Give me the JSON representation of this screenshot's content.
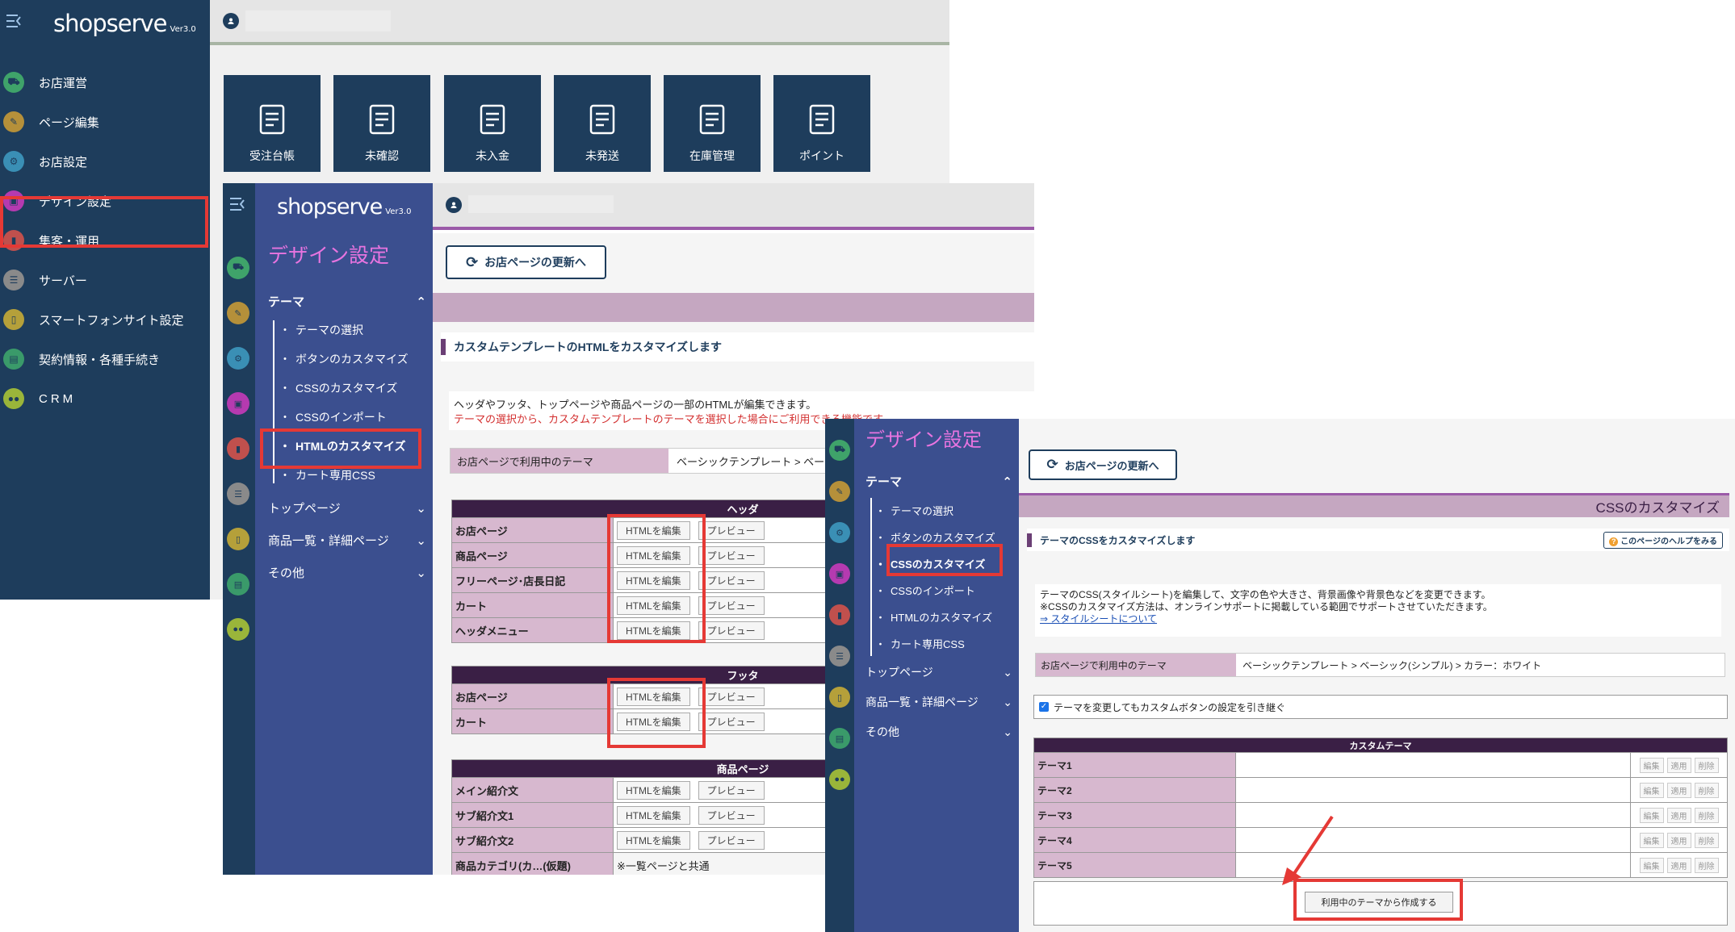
{
  "brand": {
    "name": "shopserve",
    "version": "Ver3.0"
  },
  "panel1": {
    "nav": [
      {
        "label": "お店運営",
        "icon": "cart-icon",
        "color": "#3fa36a"
      },
      {
        "label": "ページ編集",
        "icon": "edit-icon",
        "color": "#b5903a"
      },
      {
        "label": "お店設定",
        "icon": "gear-icon",
        "color": "#3a8fb5"
      },
      {
        "label": "デザイン設定",
        "icon": "layout-icon",
        "color": "#b53ab0"
      },
      {
        "label": "集客・運用",
        "icon": "chart-icon",
        "color": "#c0504d"
      },
      {
        "label": "サーバー",
        "icon": "server-icon",
        "color": "#8a8a8a"
      },
      {
        "label": "スマートフォンサイト設定",
        "icon": "smartphone-icon",
        "color": "#b5a03a"
      },
      {
        "label": "契約情報・各種手続き",
        "icon": "document-icon",
        "color": "#3a9a6a"
      },
      {
        "label": "CRM",
        "icon": "users-icon",
        "color": "#9ab53a"
      }
    ],
    "tiles": [
      {
        "label": "受注台帳",
        "icon": "clipboard-icon"
      },
      {
        "label": "未確認",
        "icon": "search-document-icon"
      },
      {
        "label": "未入金",
        "icon": "card-icon"
      },
      {
        "label": "未発送",
        "icon": "truck-icon"
      },
      {
        "label": "在庫管理",
        "icon": "box-icon"
      },
      {
        "label": "ポイント",
        "icon": "coins-icon"
      }
    ]
  },
  "panel2": {
    "title": "デザイン設定",
    "refresh_button": "お店ページの更新へ",
    "sections": {
      "theme": "テーマ",
      "top": "トップページ",
      "goods": "商品一覧・詳細ページ",
      "other": "その他"
    },
    "theme_items": [
      "テーマの選択",
      "ボタンのカスタマイズ",
      "CSSのカスタマイズ",
      "CSSのインポート",
      "HTMLのカスタマイズ",
      "カート専用CSS"
    ],
    "heading": "カスタムテンプレートのHTMLをカスタマイズします",
    "desc1": "ヘッダやフッタ、トップページや商品ページの一部のHTMLが編集できます。",
    "desc2": "テーマの選択から、カスタムテンプレートのテーマを選択した場合にご利用できる機能です。",
    "current_theme_label": "お店ページで利用中のテーマ",
    "current_theme_value": "ベーシックテンプレート > ベーシッ",
    "edit_label": "HTMLを編集",
    "preview_label": "プレビュー",
    "header_table": {
      "title": "ヘッダ",
      "rows": [
        "お店ページ",
        "商品ページ",
        "フリーページ･店長日記",
        "カート",
        "ヘッダメニュー"
      ]
    },
    "footer_table": {
      "title": "フッタ",
      "rows": [
        "お店ページ",
        "カート"
      ]
    },
    "goods_table": {
      "title": "商品ページ",
      "rows": [
        "メイン紹介文",
        "サブ紹介文1",
        "サブ紹介文2"
      ],
      "cut_label": "商品カテゴリ(カ…(仮題)",
      "cut_note": "※一覧ページと共通"
    }
  },
  "panel3": {
    "title": "デザイン設定",
    "refresh_button": "お店ページの更新へ",
    "band_title": "CSSのカスタマイズ",
    "heading": "テーマのCSSをカスタマイズします",
    "help_button": "このページのヘルプをみる",
    "desc1": "テーマのCSS(スタイルシート)を編集して、文字の色や大きさ、背景画像や背景色などを変更できます。",
    "desc2": "※CSSのカスタマイズ方法は、オンラインサポートに掲載している範囲でサポートさせていただきます。",
    "desc_link": "⇒ スタイルシートについて",
    "current_theme_label": "お店ページで利用中のテーマ",
    "current_theme_value": "ベーシックテンプレート > ベーシック(シンプル) > カラー：ホワイト",
    "checkbox_label": "テーマを変更してもカスタムボタンの設定を引き継ぐ",
    "custom_theme_title": "カスタムテーマ",
    "themes": [
      "テーマ1",
      "テーマ2",
      "テーマ3",
      "テーマ4",
      "テーマ5"
    ],
    "row_buttons": [
      "編集",
      "適用",
      "削除"
    ],
    "create_button": "利用中のテーマから作成する"
  }
}
